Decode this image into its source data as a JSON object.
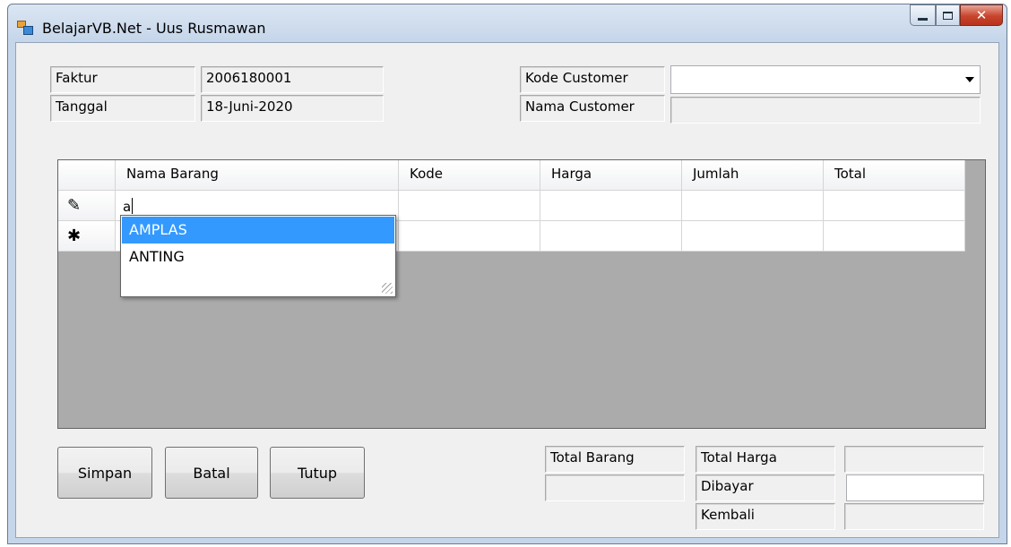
{
  "window": {
    "title": "BelajarVB.Net - Uus Rusmawan"
  },
  "header_fields": {
    "faktur_label": "Faktur",
    "faktur_value": "2006180001",
    "tanggal_label": "Tanggal",
    "tanggal_value": "18-Juni-2020",
    "kode_customer_label": "Kode Customer",
    "kode_customer_value": "",
    "nama_customer_label": "Nama Customer",
    "nama_customer_value": ""
  },
  "grid": {
    "columns": [
      "Nama Barang",
      "Kode",
      "Harga",
      "Jumlah",
      "Total"
    ],
    "row_editing_icon": "pencil-icon",
    "row_new_icon": "asterisk-icon",
    "editing_text": "a",
    "autocomplete": [
      "AMPLAS",
      "ANTING"
    ],
    "autocomplete_selected": 0
  },
  "buttons": {
    "simpan": "Simpan",
    "batal": "Batal",
    "tutup": "Tutup"
  },
  "totals": {
    "total_barang_label": "Total Barang",
    "total_barang_value": "",
    "total_harga_label": "Total Harga",
    "total_harga_value": "",
    "dibayar_label": "Dibayar",
    "dibayar_value": "",
    "kembali_label": "Kembali",
    "kembali_value": ""
  },
  "colors": {
    "selection": "#3399ff",
    "grid_background": "#ababab",
    "close_button": "#c8442d"
  }
}
